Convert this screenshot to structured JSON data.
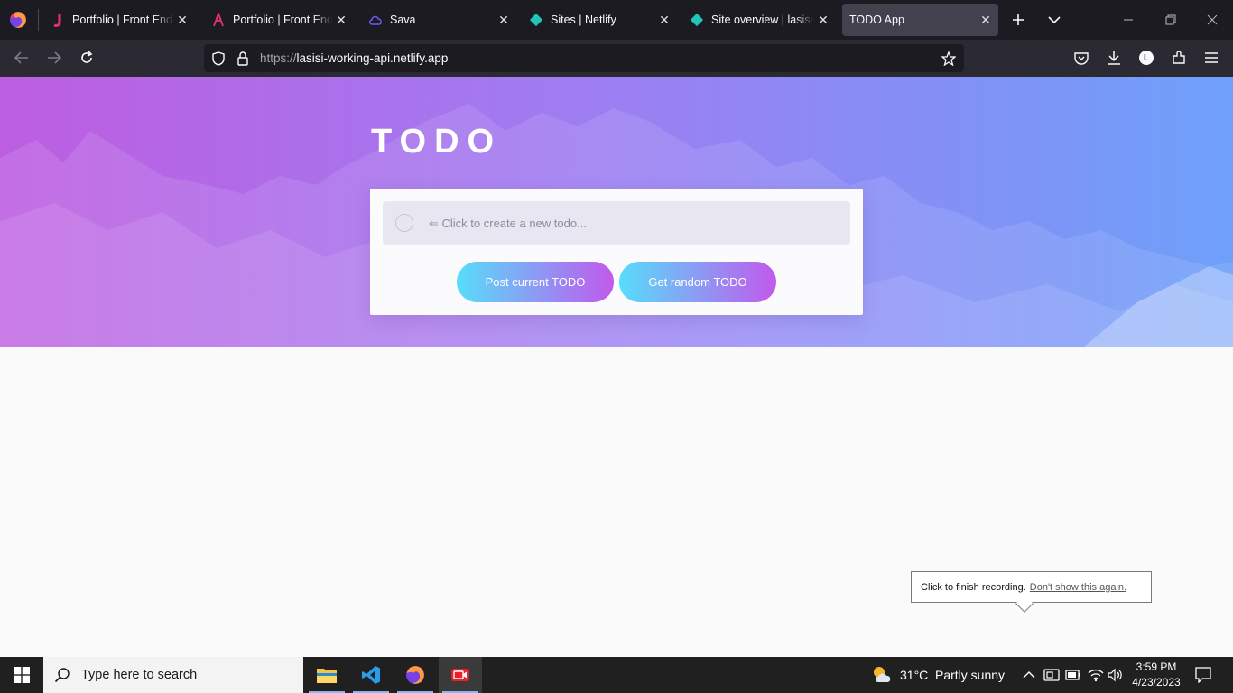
{
  "browser": {
    "tabs": [
      {
        "title": "Portfolio | Front End Developer",
        "favicon": "j-logo-icon",
        "active": false
      },
      {
        "title": "Portfolio | Front End Developer",
        "favicon": "a-logo-icon",
        "active": false
      },
      {
        "title": "Sava",
        "favicon": "cloud-icon",
        "active": false
      },
      {
        "title": "Sites | Netlify",
        "favicon": "netlify-icon",
        "active": false
      },
      {
        "title": "Site overview | lasisi-working-api",
        "favicon": "netlify-icon",
        "active": true
      },
      {
        "title": "TODO App",
        "favicon": "",
        "active": true
      }
    ],
    "url_scheme": "https://",
    "url_host": "lasisi-working-api.netlify.app",
    "profile_initial": "L"
  },
  "page": {
    "title": "TODO",
    "input_placeholder": "⇐ Click to create a new todo...",
    "post_button": "Post current TODO",
    "random_button": "Get random TODO",
    "colors": {
      "gradient_start": "#57ddfb",
      "gradient_end": "#c159ec"
    }
  },
  "recording_tip": {
    "text": "Click to finish recording.",
    "link": "Don't show this again."
  },
  "taskbar": {
    "search_placeholder": "Type here to search",
    "weather_temp": "31°C",
    "weather_desc": "Partly sunny",
    "time": "3:59 PM",
    "date": "4/23/2023"
  }
}
